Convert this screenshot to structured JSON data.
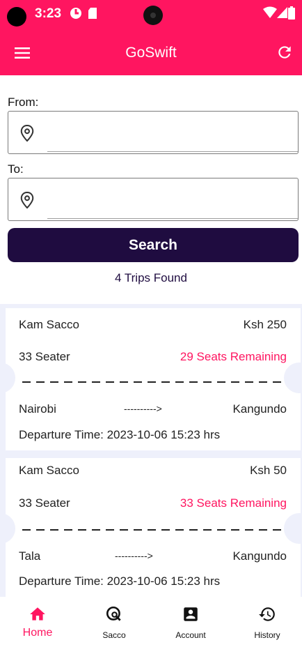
{
  "status_bar": {
    "time": "3:23",
    "icons": [
      "camera-dot-icon",
      "g-badge-icon",
      "sd-card-icon",
      "wifi-icon",
      "signal-icon",
      "battery-icon"
    ]
  },
  "app_bar": {
    "title": "GoSwift",
    "icons": [
      "menu-icon",
      "refresh-icon"
    ]
  },
  "search_form": {
    "from_label": "From:",
    "from_value": "",
    "to_label": "To:",
    "to_value": "",
    "search_label": "Search",
    "results_text": "4 Trips Found"
  },
  "trips": [
    {
      "sacco": "Kam Sacco",
      "price": "Ksh 250",
      "capacity": "33 Seater",
      "seats_remaining": "29 Seats Remaining",
      "origin": "Nairobi",
      "arrow": "---------->",
      "destination": "Kangundo",
      "departure": "Departure Time: 2023-10-06 15:23 hrs"
    },
    {
      "sacco": "Kam Sacco",
      "price": "Ksh 50",
      "capacity": "33 Seater",
      "seats_remaining": "33 Seats Remaining",
      "origin": "Tala",
      "arrow": "---------->",
      "destination": "Kangundo",
      "departure": "Departure Time: 2023-10-06 15:23 hrs"
    }
  ],
  "bottom_nav": [
    {
      "label": "Home",
      "icon": "home-icon",
      "active": true
    },
    {
      "label": "Sacco",
      "icon": "sacco-search-icon",
      "active": false
    },
    {
      "label": "Account",
      "icon": "account-icon",
      "active": false
    },
    {
      "label": "History",
      "icon": "history-icon",
      "active": false
    }
  ],
  "colors": {
    "primary": "#ff1560",
    "dark": "#1f0c40",
    "list_bg": "#eef0fb"
  }
}
